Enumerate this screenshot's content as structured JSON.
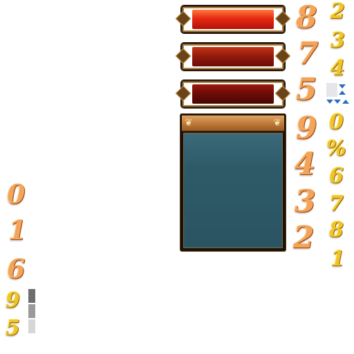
{
  "orange_digits_right": [
    "8",
    "7",
    "5",
    "9",
    "4",
    "3",
    "2"
  ],
  "yellow_digits_right": [
    "2",
    "3",
    "4",
    "0",
    "%",
    "6",
    "7",
    "8",
    "1"
  ],
  "orange_digits_left": [
    "0",
    "1",
    "6"
  ],
  "yellow_digits_left": [
    "9",
    "5"
  ],
  "colors": {
    "orange_glyph": "#f2a55a",
    "yellow_glyph": "#efc52a",
    "panel_header": "#c17c3c",
    "panel_body": "#2e5a68",
    "bar_bright": "#e62a12",
    "bar_mid": "#8f1a0c",
    "bar_dark": "#6a0c06"
  },
  "icons": {
    "panel_corner": "ornate-scroll-icon",
    "arrows": "blue-arrow-icon"
  }
}
